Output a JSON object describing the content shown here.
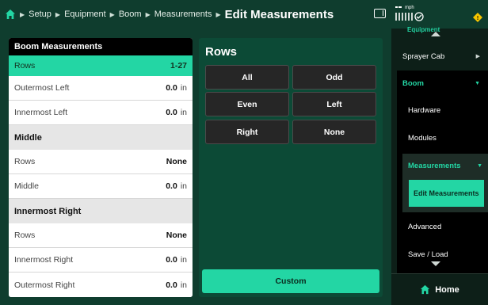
{
  "header": {
    "breadcrumbs": [
      "Setup",
      "Equipment",
      "Boom",
      "Measurements"
    ],
    "title": "Edit Measurements"
  },
  "status": {
    "speed_unit": "mph"
  },
  "table": {
    "header": "Boom Measurements",
    "selected_row": {
      "label": "Rows",
      "value": "1-27"
    },
    "rows_top": [
      {
        "label": "Outermost Left",
        "value": "0.0",
        "unit": "in"
      },
      {
        "label": "Innermost Left",
        "value": "0.0",
        "unit": "in"
      }
    ],
    "middle_section": "Middle",
    "middle_rows": [
      {
        "label": "Rows",
        "value": "None"
      },
      {
        "label": "Middle",
        "value": "0.0",
        "unit": "in"
      }
    ],
    "right_section": "Innermost Right",
    "right_rows": [
      {
        "label": "Rows",
        "value": "None"
      },
      {
        "label": "Innermost Right",
        "value": "0.0",
        "unit": "in"
      },
      {
        "label": "Outermost Right",
        "value": "0.0",
        "unit": "in"
      }
    ]
  },
  "rows_panel": {
    "title": "Rows",
    "options": [
      "All",
      "Odd",
      "Even",
      "Left",
      "Right",
      "None"
    ],
    "custom": "Custom"
  },
  "nav": {
    "top_partial": "Equipment",
    "items": {
      "sprayer_cab": "Sprayer Cab",
      "boom": "Boom",
      "hardware": "Hardware",
      "modules": "Modules",
      "measurements": "Measurements",
      "edit_measurements": "Edit Measurements",
      "advanced": "Advanced",
      "save_load": "Save / Load"
    },
    "home": "Home"
  },
  "colors": {
    "accent": "#23d6a4",
    "background": "#0f3d2e",
    "panel": "#0c4a36"
  }
}
